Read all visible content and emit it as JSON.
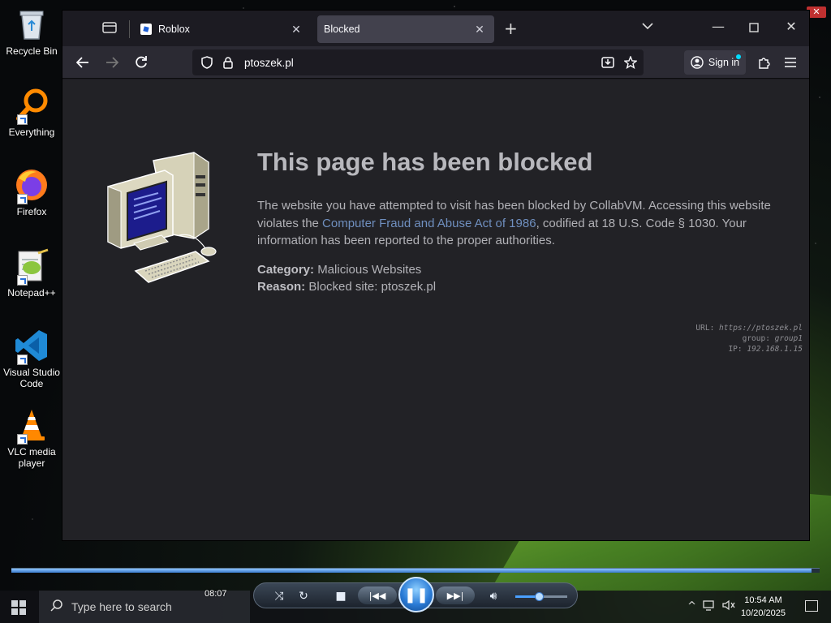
{
  "desktop": {
    "icons": [
      {
        "label": "Recycle Bin"
      },
      {
        "label": "Everything"
      },
      {
        "label": "Firefox"
      },
      {
        "label": "Notepad++"
      },
      {
        "label": "Visual Studio Code"
      },
      {
        "label": "VLC media player"
      }
    ]
  },
  "browser": {
    "tabs": [
      {
        "title": "Roblox",
        "close": "✕"
      },
      {
        "title": "Blocked",
        "close": "✕"
      }
    ],
    "url": "ptoszek.pl",
    "sign_in_label": "Sign in",
    "colors": {
      "accent": "#00ddff",
      "page_bg": "#222226",
      "link": "#6f8fbf"
    }
  },
  "blocked_page": {
    "title": "This page has been blocked",
    "desc_before_link": "The website you have attempted to visit has been blocked by CollabVM. Accessing this website violates the ",
    "link_text": "Computer Fraud and Abuse Act of 1986",
    "desc_after_link": ", codified at 18 U.S. Code § 1030. Your information has been reported to the proper authorities.",
    "category_label": "Category:",
    "category_value": "Malicious Websites",
    "reason_label": "Reason:",
    "reason_value": "Blocked site: ptoszek.pl",
    "tech": {
      "url_label": "URL:",
      "url_value": "https://ptoszek.pl",
      "group_label": "group:",
      "group_value": "group1",
      "ip_label": "IP:",
      "ip_value": "192.168.1.15"
    }
  },
  "media_player": {
    "time": "08:07",
    "progress": 0.99,
    "volume": 0.45
  },
  "taskbar": {
    "search_placeholder": "Type here to search",
    "time": "10:54 AM",
    "date": "10/20/2025"
  }
}
